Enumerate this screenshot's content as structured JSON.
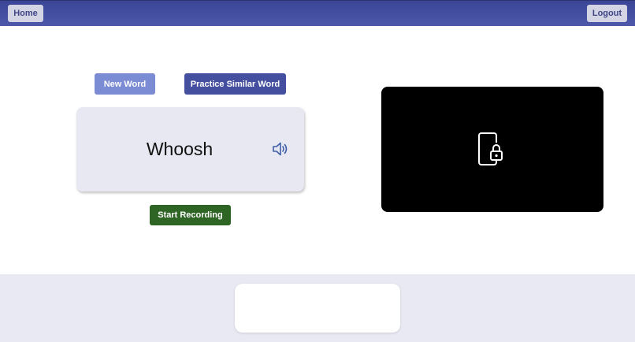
{
  "header": {
    "home_label": "Home",
    "logout_label": "Logout"
  },
  "controls": {
    "new_word_label": "New Word",
    "practice_similar_label": "Practice Similar Word",
    "start_recording_label": "Start Recording"
  },
  "word_card": {
    "word": "Whoosh",
    "speaker_icon": "speaker-icon"
  },
  "camera": {
    "icon": "phone-lock-icon"
  },
  "colors": {
    "header": "#4e58ab",
    "new_word_button": "#7b8bd4",
    "similar_button": "#44509f",
    "record_button": "#2f6524",
    "card_background": "#e8e8f3",
    "footer_background": "#e9e9f3"
  }
}
